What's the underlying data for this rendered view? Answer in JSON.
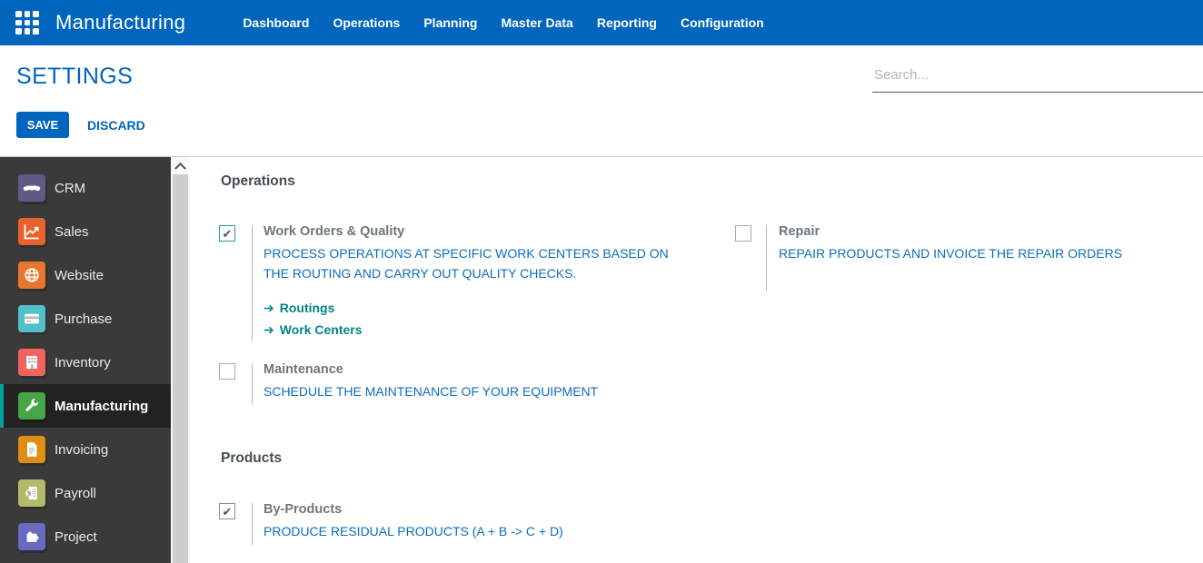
{
  "topbar": {
    "app_title": "Manufacturing",
    "menu": [
      "Dashboard",
      "Operations",
      "Planning",
      "Master Data",
      "Reporting",
      "Configuration"
    ],
    "bg_color": "#0065bd"
  },
  "header": {
    "title": "SETTINGS",
    "save_label": "SAVE",
    "discard_label": "DISCARD",
    "search_placeholder": "Search...",
    "accent_color": "#0065bd"
  },
  "sidebar": {
    "active_accent_color": "#00a09d",
    "items": [
      {
        "label": "CRM",
        "icon": "crm-handshake-icon",
        "color": "#615b84",
        "active": false
      },
      {
        "label": "Sales",
        "icon": "sales-chart-icon",
        "color": "#e8632c",
        "active": false
      },
      {
        "label": "Website",
        "icon": "website-globe-icon",
        "color": "#e8762c",
        "active": false
      },
      {
        "label": "Purchase",
        "icon": "purchase-card-icon",
        "color": "#50c1ca",
        "active": false
      },
      {
        "label": "Inventory",
        "icon": "inventory-building-icon",
        "color": "#ef645f",
        "active": false
      },
      {
        "label": "Manufacturing",
        "icon": "manufacturing-wrench-icon",
        "color": "#47a447",
        "active": true
      },
      {
        "label": "Invoicing",
        "icon": "invoicing-document-icon",
        "color": "#de8e13",
        "active": false
      },
      {
        "label": "Payroll",
        "icon": "payroll-money-icon",
        "color": "#b3bb68",
        "active": false
      },
      {
        "label": "Project",
        "icon": "project-puzzle-icon",
        "color": "#6a6ac0",
        "active": false
      }
    ]
  },
  "settings": {
    "link_color": "#008784",
    "description_color": "#0c6dbd",
    "sections": [
      {
        "title": "Operations",
        "items": [
          {
            "label": "Work Orders & Quality",
            "checked": true,
            "description": "PROCESS OPERATIONS AT SPECIFIC WORK CENTERS BASED ON THE ROUTING AND CARRY OUT QUALITY CHECKS.",
            "links": [
              {
                "label": "Routings"
              },
              {
                "label": "Work Centers"
              }
            ]
          },
          {
            "label": "Repair",
            "checked": false,
            "description": "REPAIR PRODUCTS AND INVOICE THE REPAIR ORDERS"
          },
          {
            "label": "Maintenance",
            "checked": false,
            "description": "SCHEDULE THE MAINTENANCE OF YOUR EQUIPMENT"
          }
        ]
      },
      {
        "title": "Products",
        "items": [
          {
            "label": "By-Products",
            "checked": true,
            "description": "PRODUCE RESIDUAL PRODUCTS (A + B -> C + D)"
          }
        ]
      }
    ]
  }
}
